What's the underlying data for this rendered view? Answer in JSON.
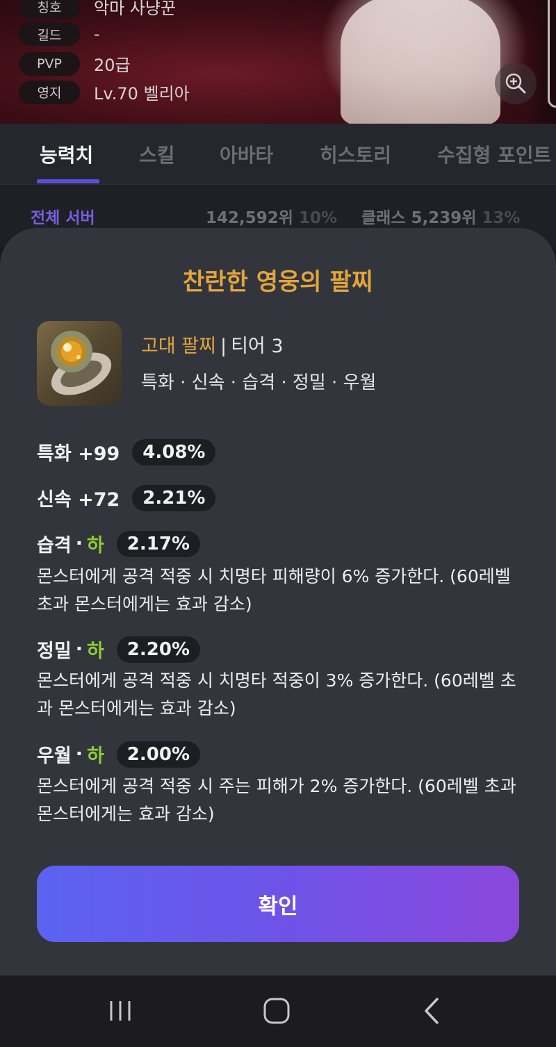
{
  "profile": {
    "rows": [
      {
        "label": "칭호",
        "value": "악마 사냥꾼"
      },
      {
        "label": "길드",
        "value": "-"
      },
      {
        "label": "PVP",
        "value": "20급"
      },
      {
        "label": "영지",
        "value": "Lv.70 벨리아"
      }
    ],
    "zoom_icon": "zoom-in-icon"
  },
  "tabs": [
    {
      "label": "능력치",
      "active": true
    },
    {
      "label": "스킬",
      "active": false
    },
    {
      "label": "아바타",
      "active": false
    },
    {
      "label": "히스토리",
      "active": false
    },
    {
      "label": "수집형 포인트",
      "active": false
    }
  ],
  "ranking": {
    "label": "전체 서버",
    "server_rank": "142,592위",
    "server_pct": "10%",
    "class_rank": "클래스 5,239위",
    "class_pct": "13%"
  },
  "dialog": {
    "title": "찬란한 영웅의 팔찌",
    "item": {
      "grade": "고대 팔찌",
      "separator": "|",
      "tier": "티어 3",
      "stats_summary": "특화 · 신속 · 습격 · 정밀 · 우월"
    },
    "stats": [
      {
        "name": "특화 +99",
        "pct": "4.08%"
      },
      {
        "name": "신속 +72",
        "pct": "2.21%"
      }
    ],
    "effects": [
      {
        "name": "습격",
        "dot": "·",
        "grade": "하",
        "pct": "2.17%",
        "desc": "몬스터에게 공격 적중 시 치명타 피해량이 6% 증가한다. (60레벨 초과 몬스터에게는 효과 감소)"
      },
      {
        "name": "정밀",
        "dot": "·",
        "grade": "하",
        "pct": "2.20%",
        "desc": "몬스터에게 공격 적중 시 치명타 적중이 3% 증가한다. (60레벨 초과 몬스터에게는 효과 감소)"
      },
      {
        "name": "우월",
        "dot": "·",
        "grade": "하",
        "pct": "2.00%",
        "desc": "몬스터에게 공격 적중 시 주는 피해가 2% 증가한다. (60레벨 초과 몬스터에게는 효과 감소)"
      }
    ],
    "confirm_label": "확인"
  },
  "colors": {
    "accent_gold": "#e3a53b",
    "grade_green": "#8ccf33",
    "tab_indicator": "#5a4fd6",
    "button_start": "#5b63f0",
    "button_end": "#8a47dc"
  },
  "system_nav": {
    "recents_icon": "recents-icon",
    "home_icon": "home-icon",
    "back_icon": "back-icon"
  }
}
